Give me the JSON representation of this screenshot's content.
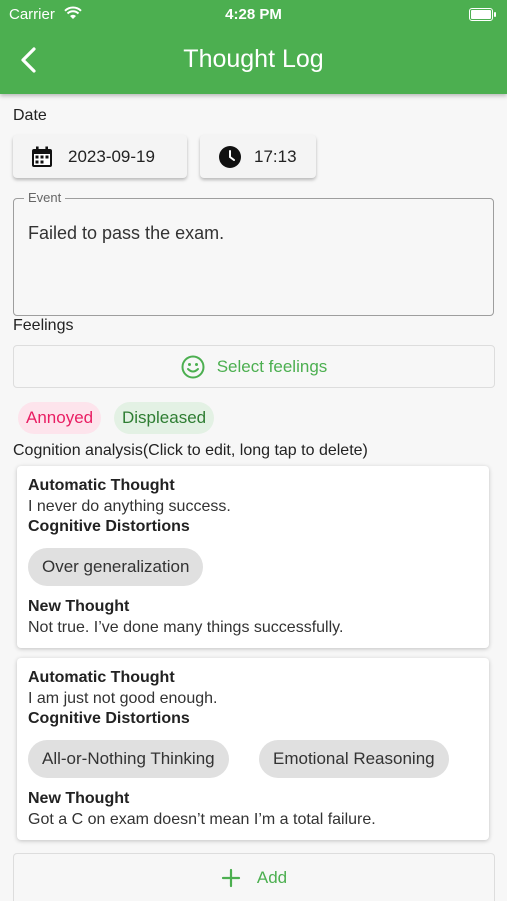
{
  "status_bar": {
    "carrier": "Carrier",
    "time": "4:28 PM"
  },
  "header": {
    "title": "Thought Log"
  },
  "date_section": {
    "label": "Date",
    "date": "2023-09-19",
    "time": "17:13"
  },
  "event": {
    "legend": "Event",
    "value": "Failed to pass the exam."
  },
  "feelings": {
    "label": "Feelings",
    "select_label": "Select feelings",
    "tags": [
      "Annoyed",
      "Displeased"
    ]
  },
  "cognition": {
    "label": "Cognition analysis(Click to edit, long tap to delete)",
    "entries": [
      {
        "auto_heading": "Automatic Thought",
        "auto_text": "I never do anything success.",
        "dist_heading": "Cognitive Distortions",
        "distortions": [
          "Over generalization"
        ],
        "new_heading": "New Thought",
        "new_text": "Not true. I’ve done many things successfully."
      },
      {
        "auto_heading": "Automatic Thought",
        "auto_text": "I am just not good enough.",
        "dist_heading": "Cognitive Distortions",
        "distortions": [
          "All-or-Nothing Thinking",
          "Emotional Reasoning"
        ],
        "new_heading": "New Thought",
        "new_text": "Got a C on exam doesn’t mean I’m a total failure."
      }
    ],
    "add_label": "Add"
  },
  "colors": {
    "primary": "#4caf50",
    "annoyed": "#e91e63",
    "displeased": "#2e7d32"
  },
  "icons": [
    "wifi-icon",
    "battery-icon",
    "back-arrow-icon",
    "calendar-icon",
    "clock-icon",
    "smiley-icon",
    "plus-icon"
  ]
}
